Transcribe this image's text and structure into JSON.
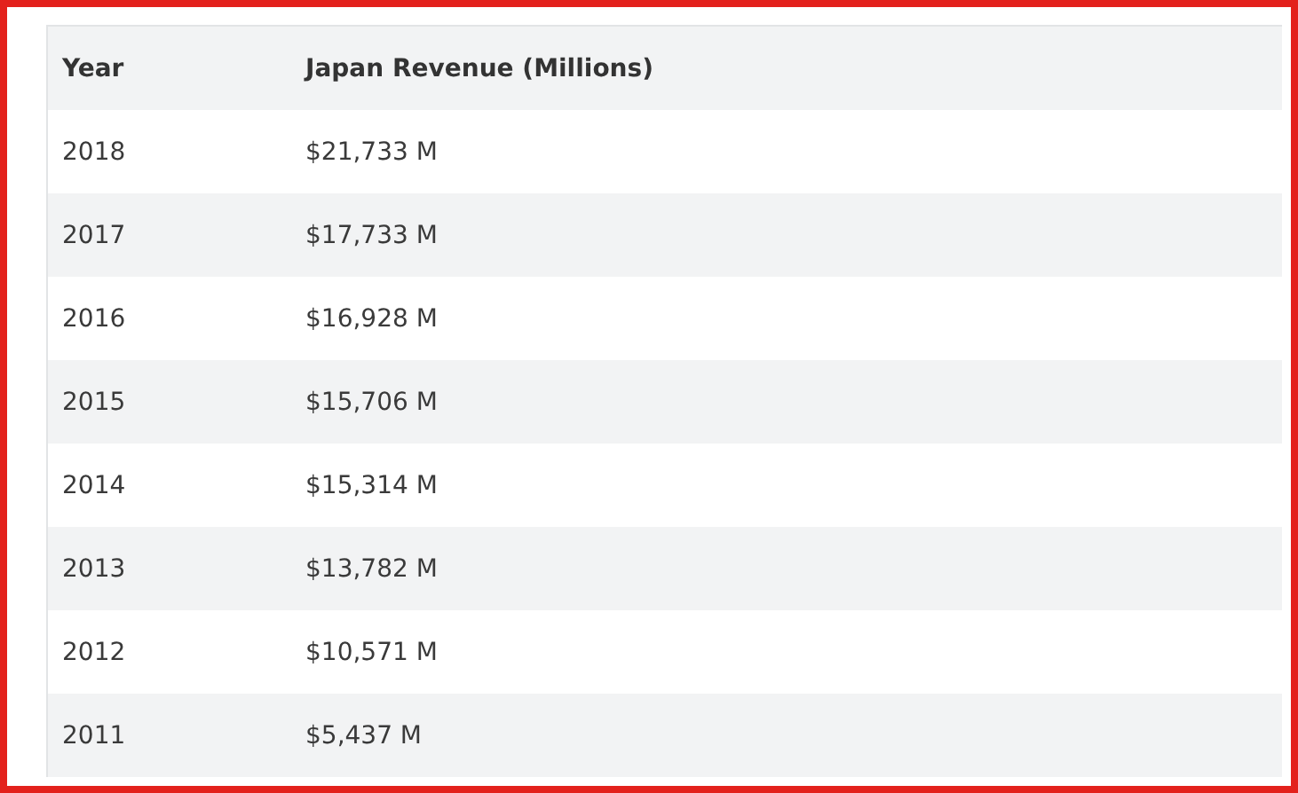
{
  "table": {
    "columns": [
      "Year",
      "Japan Revenue (Millions)"
    ],
    "rows": [
      [
        "2018",
        "$21,733 M"
      ],
      [
        "2017",
        "$17,733 M"
      ],
      [
        "2016",
        "$16,928 M"
      ],
      [
        "2015",
        "$15,706 M"
      ],
      [
        "2014",
        "$15,314 M"
      ],
      [
        "2013",
        "$13,782 M"
      ],
      [
        "2012",
        "$10,571 M"
      ],
      [
        "2011",
        "$5,437 M"
      ]
    ]
  }
}
